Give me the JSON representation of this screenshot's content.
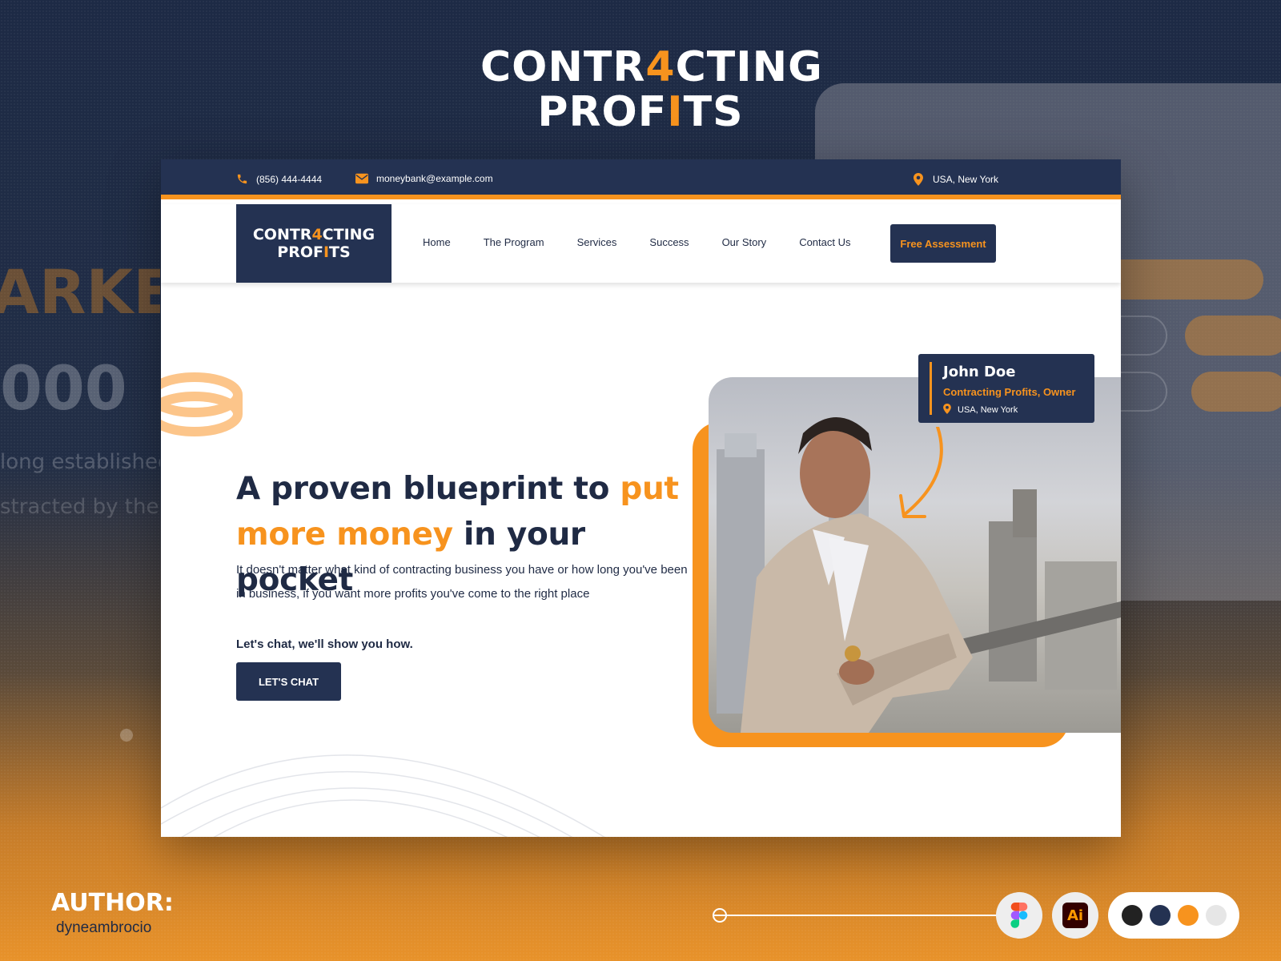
{
  "brand": {
    "line1_a": "CONTR",
    "line1_b": "4",
    "line1_c": "CTING",
    "line2_a": "PROF",
    "line2_b": "I",
    "line2_c": "TS",
    "accent_color": "#f7931e",
    "navy_color": "#243252"
  },
  "topbar": {
    "phone": "(856) 444-4444",
    "email": "moneybank@example.com",
    "location": "USA, New York",
    "phone_icon": "phone-icon",
    "email_icon": "mail-icon",
    "location_icon": "map-pin-icon"
  },
  "nav": {
    "items": [
      {
        "label": "Home"
      },
      {
        "label": "The Program"
      },
      {
        "label": "Services"
      },
      {
        "label": "Success"
      },
      {
        "label": "Our Story"
      },
      {
        "label": "Contact Us"
      }
    ],
    "cta": "Free Assessment"
  },
  "hero": {
    "title_1": "A proven blueprint to ",
    "title_hl_1": "put more money",
    "title_2": " in your pocket",
    "description": "It doesn't matter what kind of contracting business you have or how long you've been in business, if you want more profits you've come to the right place",
    "cta_text": "Let's chat, we'll show you how.",
    "button": "LET'S CHAT"
  },
  "profile_card": {
    "name": "John Doe",
    "role": "Contracting Profits, Owner",
    "location": "USA, New York"
  },
  "author": {
    "label": "AUTHOR:",
    "name": "dyneambrocio"
  },
  "tools": [
    "figma-icon",
    "illustrator-icon"
  ],
  "illustrator_label": "Ai",
  "palette": [
    "#222222",
    "#243252",
    "#f7931e",
    "#e6e6e6"
  ]
}
